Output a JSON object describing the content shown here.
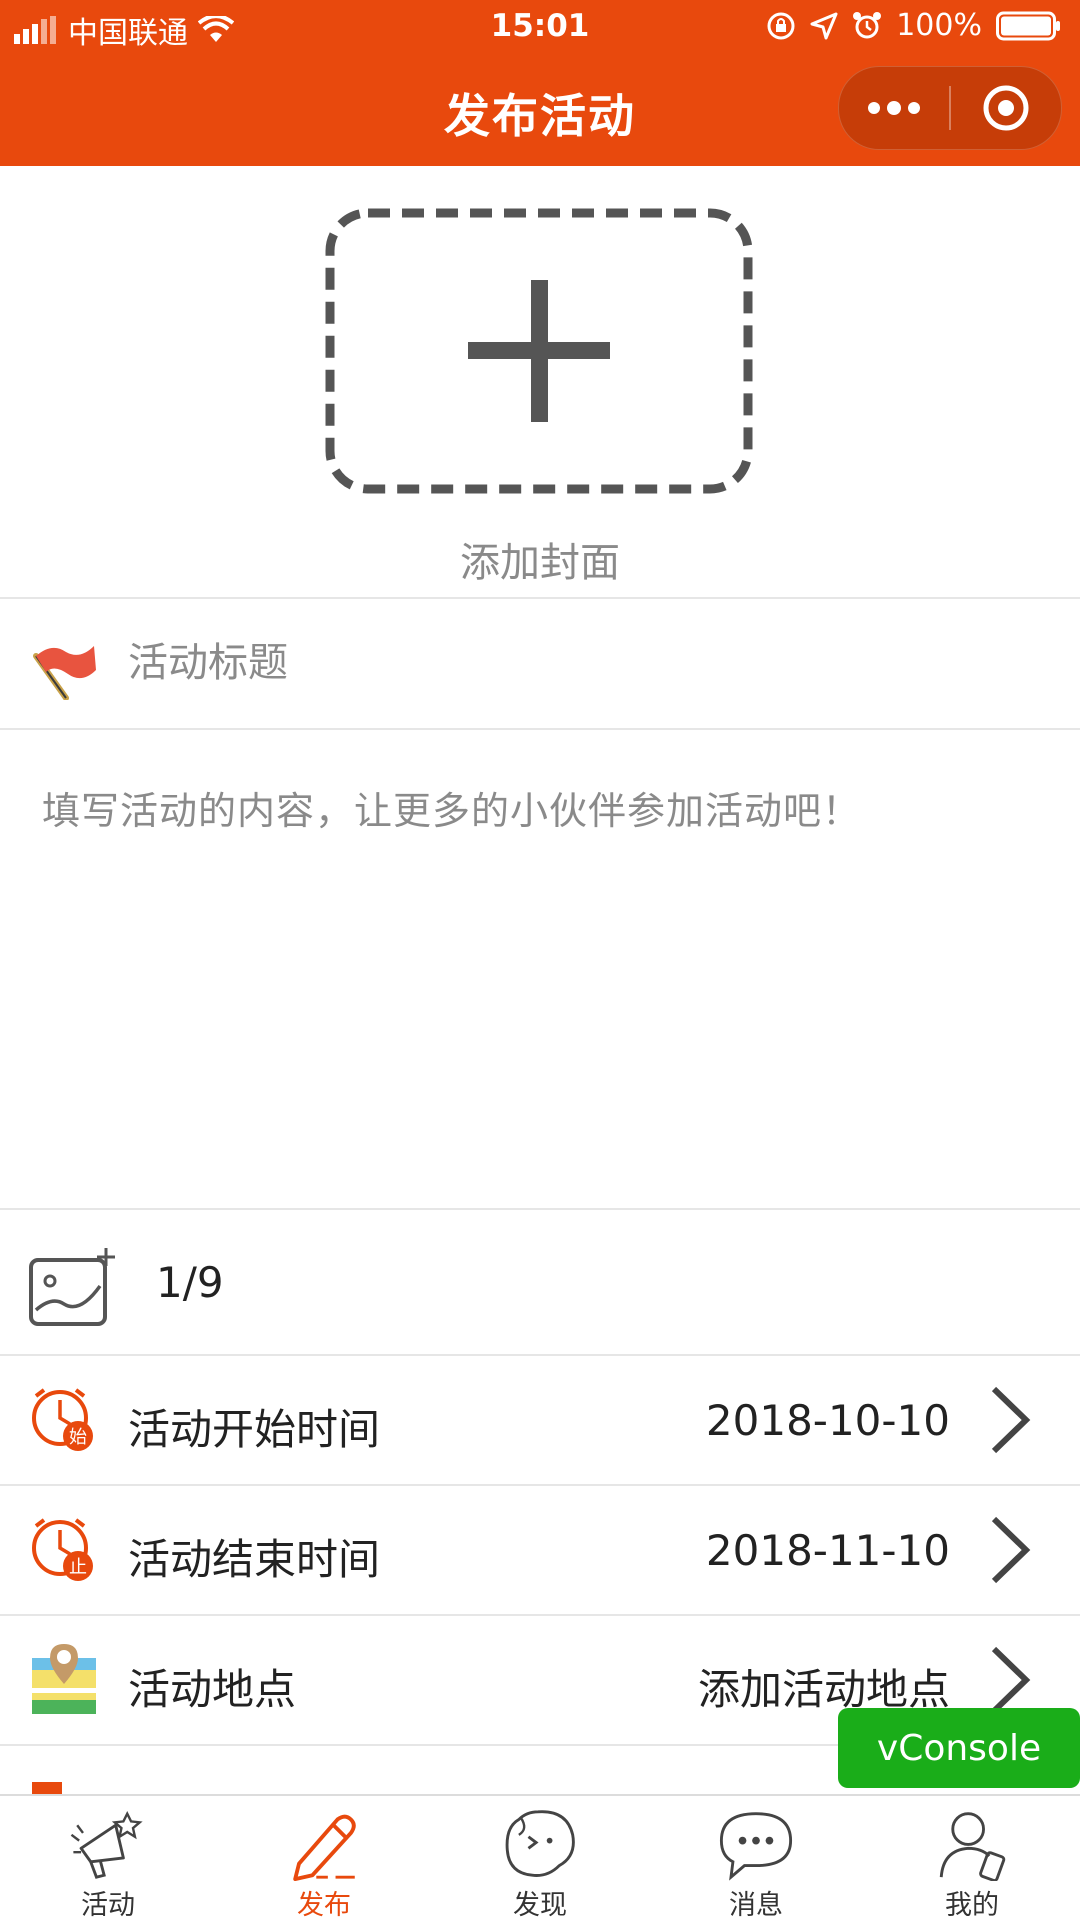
{
  "status_bar": {
    "carrier": "中国联通",
    "time": "15:01",
    "battery": "100%"
  },
  "nav": {
    "title": "发布活动"
  },
  "cover": {
    "label": "添加封面"
  },
  "form": {
    "title_placeholder": "活动标题",
    "content_placeholder": "填写活动的内容，让更多的小伙伴参加活动吧！",
    "image_count": "1/9",
    "items": [
      {
        "label": "活动开始时间",
        "value": "2018-10-10",
        "icon": "clock-start-icon",
        "badge": "始"
      },
      {
        "label": "活动结束时间",
        "value": "2018-11-10",
        "icon": "clock-end-icon",
        "badge": "止"
      },
      {
        "label": "活动地点",
        "value": "添加活动地点",
        "icon": "map-icon"
      }
    ]
  },
  "vconsole": {
    "label": "vConsole"
  },
  "tabbar": {
    "items": [
      {
        "label": "活动",
        "icon": "megaphone-icon",
        "active": false
      },
      {
        "label": "发布",
        "icon": "pencil-icon",
        "active": true
      },
      {
        "label": "发现",
        "icon": "discover-icon",
        "active": false
      },
      {
        "label": "消息",
        "icon": "chat-bubble-icon",
        "active": false
      },
      {
        "label": "我的",
        "icon": "profile-icon",
        "active": false
      }
    ]
  },
  "colors": {
    "brand": "#e8490d",
    "vconsole": "#1aad19"
  }
}
